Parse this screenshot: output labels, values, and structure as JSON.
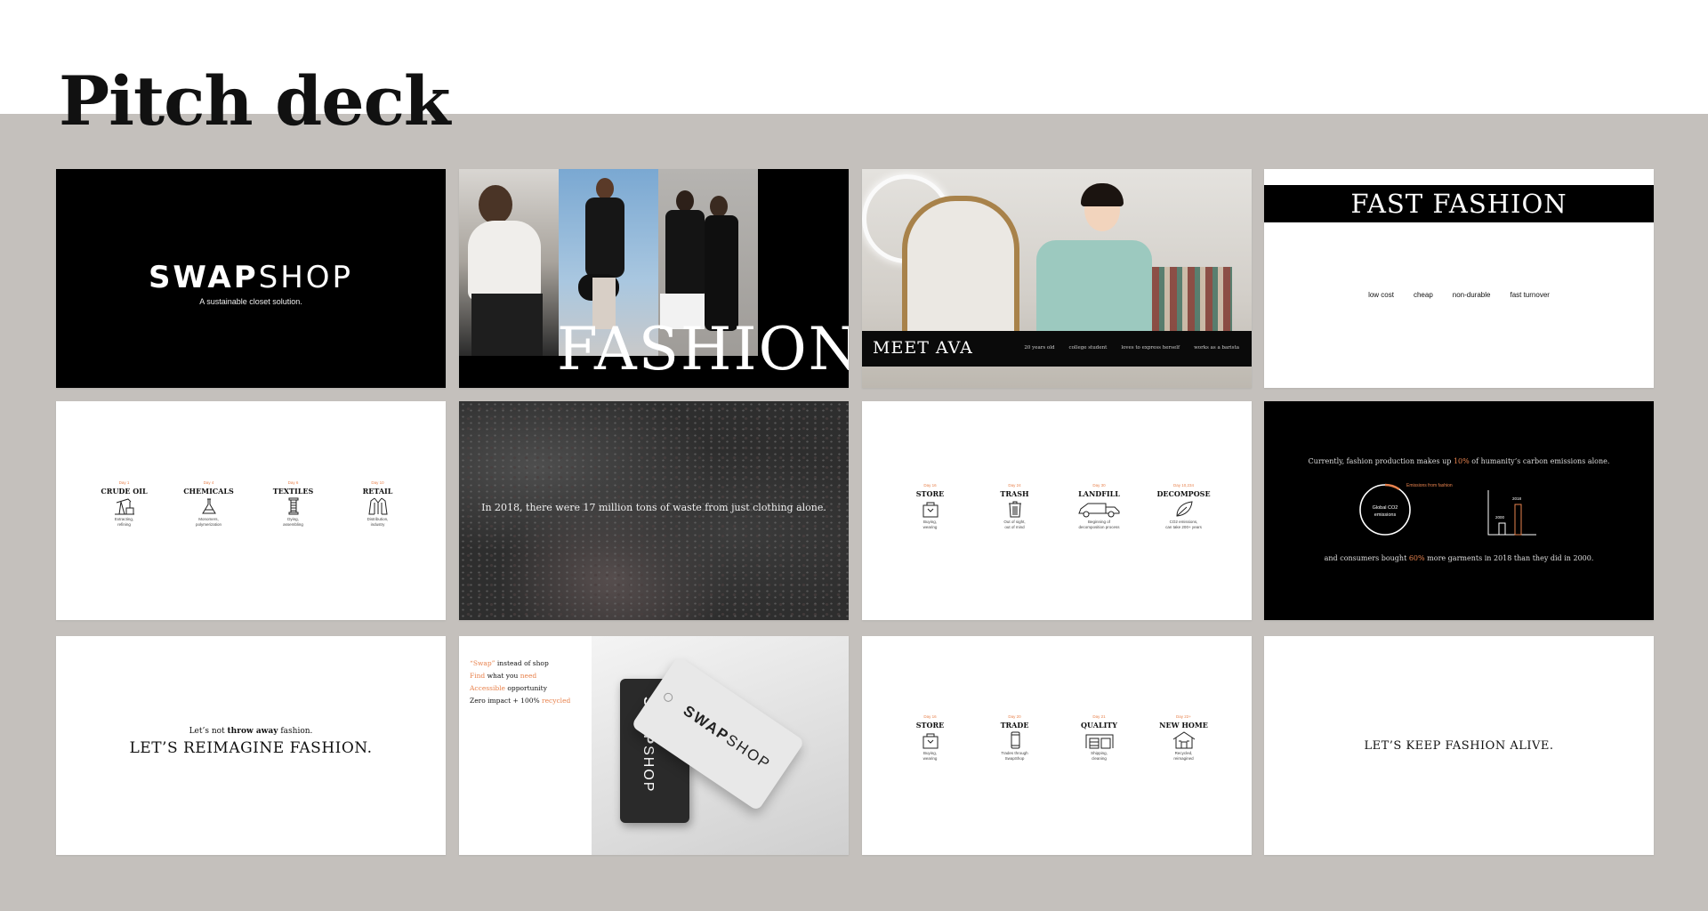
{
  "page": {
    "title": "Pitch deck"
  },
  "colors": {
    "accent": "#e8834e",
    "band": "#c4c0bc"
  },
  "slide1": {
    "logo_bold": "SWAP",
    "logo_light": "SHOP",
    "tagline": "A sustainable closet solution."
  },
  "slide2": {
    "title": "FASHION"
  },
  "slide3": {
    "title": "MEET AVA",
    "facts": [
      "20 years old",
      "college student",
      "loves to express herself",
      "works as a barista"
    ]
  },
  "slide4": {
    "title": "FAST FASHION",
    "words": [
      "low cost",
      "cheap",
      "non-durable",
      "fast turnover"
    ]
  },
  "slide5": {
    "steps": [
      {
        "day": "Day 1",
        "name": "CRUDE OIL",
        "desc": "Extracting,\nrefining",
        "icon": "oil-pump-icon"
      },
      {
        "day": "Day 4",
        "name": "CHEMICALS",
        "desc": "Monomers,\npolymerization",
        "icon": "flask-icon"
      },
      {
        "day": "Day 6",
        "name": "TEXTILES",
        "desc": "Dying,\nassembling",
        "icon": "thread-spool-icon"
      },
      {
        "day": "Day 10",
        "name": "RETAIL",
        "desc": "Distribution,\nindustry",
        "icon": "jacket-icon"
      }
    ]
  },
  "slide6": {
    "text": "In 2018, there were 17 million tons of waste from just clothing alone."
  },
  "slide7": {
    "steps": [
      {
        "day": "Day 16",
        "name": "STORE",
        "desc": "Buying,\nwearing",
        "icon": "shopping-bag-icon"
      },
      {
        "day": "Day 24",
        "name": "TRASH",
        "desc": "Out of sight,\nout of mind",
        "icon": "trash-icon"
      },
      {
        "day": "Day 30",
        "name": "LANDFILL",
        "desc": "Beginning of\ndecomposition process",
        "icon": "truck-icon"
      },
      {
        "day": "Day 10,234",
        "name": "DECOMPOSE",
        "desc": "CO2 emissions,\ncan take 200+ years",
        "icon": "leaf-icon"
      }
    ]
  },
  "slide8": {
    "line1_pre": "Currently, fashion production makes up ",
    "line1_highlight": "10%",
    "line1_post": " of humanity’s carbon emissions alone.",
    "donut_label_1": "Global CO2",
    "donut_label_2": "emissions",
    "donut_callout": "Emissions from fashion",
    "bar_labels": [
      "2000",
      "2018"
    ],
    "line2_pre": "and consumers bought ",
    "line2_highlight": "60%",
    "line2_post": " more garments in 2018 than they did in 2000."
  },
  "slide9": {
    "small_pre": "Let’s not ",
    "small_bold": "throw away",
    "small_post": " fashion.",
    "big": "LET’S REIMAGINE FASHION."
  },
  "slide10": {
    "line1_hl": "“Swap”",
    "line1_rest": " instead of shop",
    "line2_hl1": "Find",
    "line2_mid": " what you ",
    "line2_hl2": "need",
    "line3_hl": "Accessible",
    "line3_rest": " opportunity",
    "line4_pre": "Zero impact + 100% ",
    "line4_hl": "recycled",
    "tag_bold": "SWAP",
    "tag_light": "SHOP"
  },
  "slide11": {
    "steps": [
      {
        "day": "Day 16",
        "name": "STORE",
        "desc": "Buying,\nwearing",
        "icon": "shopping-bag-icon"
      },
      {
        "day": "Day 20",
        "name": "TRADE",
        "desc": "Trades through\nSwapShop",
        "icon": "phone-icon"
      },
      {
        "day": "Day 21",
        "name": "QUALITY",
        "desc": "Shipping,\ncleaning",
        "icon": "warehouse-icon"
      },
      {
        "day": "Day 22+",
        "name": "NEW HOME",
        "desc": "Recycled,\nreimagined",
        "icon": "house-icon"
      }
    ]
  },
  "slide12": {
    "text": "LET’S KEEP FASHION ALIVE."
  }
}
